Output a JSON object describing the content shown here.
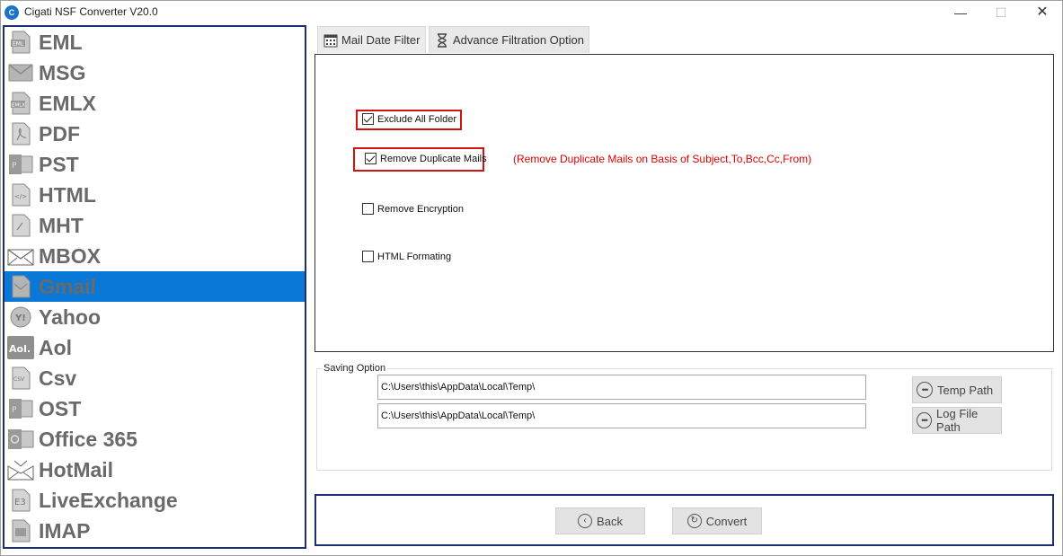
{
  "window": {
    "title": "Cigati NSF Converter V20.0",
    "app_icon_letter": "C",
    "minimize": "—",
    "maximize": "☐",
    "close": "✕"
  },
  "sidebar": {
    "items": [
      {
        "label": "EML",
        "icon": "eml-file-icon"
      },
      {
        "label": "MSG",
        "icon": "envelope-icon"
      },
      {
        "label": "EMLX",
        "icon": "emlx-file-icon"
      },
      {
        "label": "PDF",
        "icon": "pdf-file-icon"
      },
      {
        "label": "PST",
        "icon": "pst-file-icon"
      },
      {
        "label": "HTML",
        "icon": "html-file-icon"
      },
      {
        "label": "MHT",
        "icon": "mht-file-icon"
      },
      {
        "label": "MBOX",
        "icon": "mbox-envelope-icon"
      },
      {
        "label": "Gmail",
        "icon": "gmail-icon",
        "active": true
      },
      {
        "label": "Yahoo",
        "icon": "yahoo-icon"
      },
      {
        "label": "Aol",
        "icon": "aol-icon"
      },
      {
        "label": "Csv",
        "icon": "csv-file-icon"
      },
      {
        "label": "OST",
        "icon": "ost-file-icon"
      },
      {
        "label": "Office 365",
        "icon": "office365-icon"
      },
      {
        "label": "HotMail",
        "icon": "hotmail-icon"
      },
      {
        "label": "LiveExchange",
        "icon": "exchange-icon"
      },
      {
        "label": "IMAP",
        "icon": "imap-file-icon"
      }
    ],
    "active_color": "#0a78d7",
    "border_color": "#1c2f74"
  },
  "tabs": [
    {
      "label": "Mail Date Filter",
      "icon": "calendar-icon"
    },
    {
      "label": "Advance Filtration Option",
      "icon": "hourglass-icon"
    }
  ],
  "filters": {
    "exclude_all_folder": {
      "label": "Exclude All Folder",
      "checked": true
    },
    "remove_duplicate": {
      "label": "Remove Duplicate Mails",
      "checked": true
    },
    "duplicate_note": "(Remove Duplicate Mails on  Basis of Subject,To,Bcc,Cc,From)",
    "remove_encryption": {
      "label": "Remove Encryption",
      "checked": false
    },
    "html_formatting": {
      "label": "HTML Formating",
      "checked": false
    },
    "highlight_color": "#d41010"
  },
  "saving": {
    "legend": "Saving Option",
    "temp_path_value": "C:\\Users\\this\\AppData\\Local\\Temp\\",
    "log_path_value": "C:\\Users\\this\\AppData\\Local\\Temp\\",
    "temp_path_button": "Temp Path",
    "log_path_button": "Log File Path"
  },
  "footer": {
    "back_label": "Back",
    "convert_label": "Convert"
  }
}
